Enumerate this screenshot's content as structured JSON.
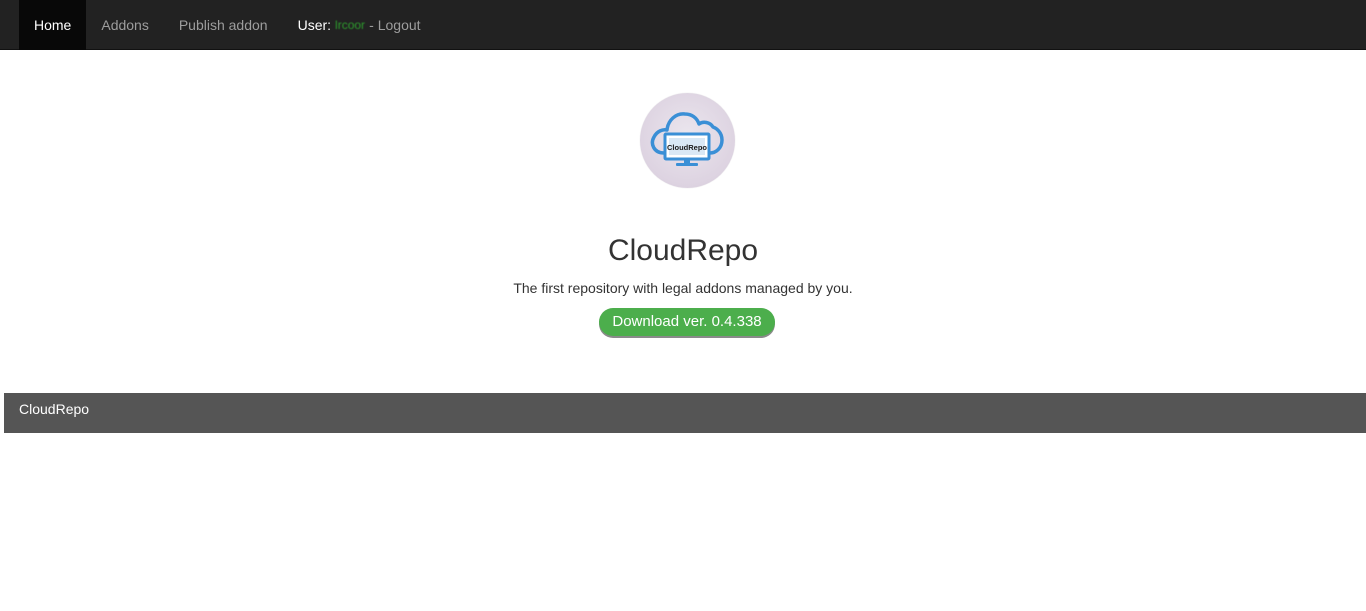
{
  "navbar": {
    "items": [
      {
        "label": "Home",
        "active": true
      },
      {
        "label": "Addons",
        "active": false
      },
      {
        "label": "Publish addon",
        "active": false
      }
    ],
    "user_label": "User:",
    "user_name": "lrcoor",
    "separator": "-",
    "logout_label": "Logout"
  },
  "hero": {
    "logo_text": "CloudRepo",
    "title": "CloudRepo",
    "subtitle": "The first repository with legal addons managed by you.",
    "download_label": "Download ver. 0.4.338"
  },
  "footer": {
    "text": "CloudRepo"
  },
  "colors": {
    "navbar_bg": "#222222",
    "active_tab_bg": "#080808",
    "download_button": "#4cae4c",
    "footer_bg": "#555555",
    "logo_blue": "#3a8fd6"
  },
  "icons": {
    "logo": "cloud-monitor-icon"
  }
}
